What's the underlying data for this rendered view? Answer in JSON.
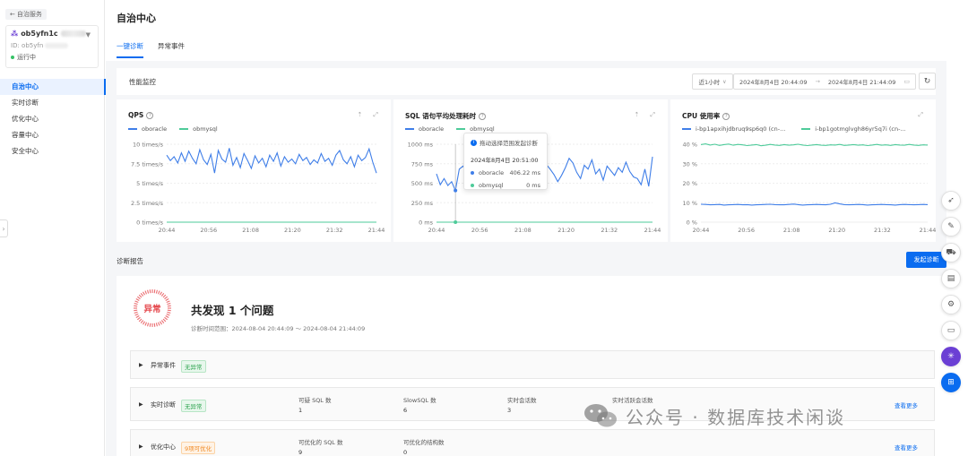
{
  "sidebar": {
    "back_label": "自治服务",
    "instance": {
      "name": "ob5yfn1c",
      "id_label": "ID: ob5yfn",
      "status": "运行中"
    },
    "nav": [
      {
        "label": "自治中心",
        "active": true
      },
      {
        "label": "实时诊断",
        "active": false
      },
      {
        "label": "优化中心",
        "active": false
      },
      {
        "label": "容量中心",
        "active": false
      },
      {
        "label": "安全中心",
        "active": false
      }
    ]
  },
  "header": {
    "title": "自治中心",
    "tabs": [
      {
        "label": "一键诊断",
        "active": true
      },
      {
        "label": "异常事件",
        "active": false
      }
    ]
  },
  "perf": {
    "title": "性能监控",
    "range": "近1小时",
    "start": "2024年8月4日 20:44:09",
    "end": "2024年8月4日 21:44:09",
    "arrow": "→"
  },
  "colors": {
    "oboracle": "#3f7ee8",
    "obmysql": "#4ecb9a",
    "accent": "#0a6cf0",
    "abnormal": "#e5484d"
  },
  "charts": [
    {
      "title": "QPS",
      "legend": [
        "oboracle",
        "obmysql"
      ]
    },
    {
      "title": "SQL 语句平均处理耗时",
      "legend": [
        "oboracle",
        "obmysql"
      ]
    },
    {
      "title": "CPU 使用率",
      "legend": [
        "i-bp1apxihjdbruq9sp6q0 (cn-...",
        "i-bp1gotmglvgh86yr5q7i (cn-..."
      ]
    }
  ],
  "chart_data": [
    {
      "type": "line",
      "title": "QPS",
      "x": [
        "20:44",
        "20:56",
        "21:08",
        "21:20",
        "21:32",
        "21:44"
      ],
      "yticks": [
        "0 times/s",
        "2.5 times/s",
        "5 times/s",
        "7.5 times/s",
        "10 times/s"
      ],
      "ylim": [
        0,
        10
      ],
      "series": [
        {
          "name": "oboracle",
          "values": [
            8.6,
            7.9,
            8.4,
            7.6,
            8.9,
            7.8,
            9.1,
            8.2,
            7.5,
            9.3,
            8.0,
            7.4,
            8.7,
            6.3,
            9.2,
            8.1,
            7.7,
            9.5,
            7.3,
            8.3,
            7.0,
            8.8,
            7.9,
            6.9,
            8.5,
            7.6,
            8.2,
            7.1,
            8.6,
            7.8,
            8.9,
            7.2,
            8.4,
            7.7,
            8.1,
            7.5,
            8.7,
            7.9,
            8.3,
            7.4,
            8.0,
            7.6,
            8.8,
            7.8,
            8.2,
            7.3,
            8.6,
            9.2,
            8.0,
            7.5,
            8.4,
            7.1,
            8.6,
            7.9,
            8.3,
            9.4,
            7.7,
            6.3
          ]
        },
        {
          "name": "obmysql",
          "values": [
            0,
            0,
            0,
            0,
            0,
            0,
            0,
            0,
            0,
            0,
            0,
            0,
            0,
            0,
            0,
            0,
            0,
            0,
            0,
            0,
            0,
            0,
            0,
            0,
            0,
            0,
            0,
            0,
            0,
            0,
            0,
            0,
            0,
            0,
            0,
            0,
            0,
            0,
            0,
            0,
            0,
            0,
            0,
            0,
            0,
            0,
            0,
            0,
            0,
            0,
            0,
            0,
            0,
            0,
            0,
            0,
            0,
            0
          ]
        }
      ]
    },
    {
      "type": "line",
      "title": "SQL 语句平均处理耗时",
      "x": [
        "20:44",
        "20:56",
        "21:08",
        "21:20",
        "21:32",
        "21:44"
      ],
      "yticks": [
        "0 ms",
        "250 ms",
        "500 ms",
        "750 ms",
        "1000 ms"
      ],
      "ylim": [
        0,
        1000
      ],
      "series": [
        {
          "name": "oboracle",
          "values": [
            620,
            480,
            560,
            470,
            520,
            406,
            680,
            720,
            650,
            800,
            590,
            520,
            700,
            640,
            610,
            560,
            620,
            540,
            680,
            820,
            600,
            520,
            760,
            640,
            700,
            560,
            620,
            590,
            700,
            740,
            680,
            610,
            520,
            600,
            700,
            820,
            760,
            640,
            560,
            730,
            680,
            800,
            620,
            680,
            540,
            720,
            660,
            600,
            700,
            640,
            770,
            650,
            580,
            560,
            480,
            680,
            460,
            840
          ]
        },
        {
          "name": "obmysql",
          "values": [
            0,
            0,
            0,
            0,
            0,
            0,
            0,
            0,
            0,
            0,
            0,
            0,
            0,
            0,
            0,
            0,
            0,
            0,
            0,
            0,
            0,
            0,
            0,
            0,
            0,
            0,
            0,
            0,
            0,
            0,
            0,
            0,
            0,
            0,
            0,
            0,
            0,
            0,
            0,
            0,
            0,
            0,
            0,
            0,
            0,
            0,
            0,
            0,
            0,
            0,
            0,
            0,
            0,
            0,
            0,
            0,
            0,
            0
          ]
        }
      ]
    },
    {
      "type": "line",
      "title": "CPU 使用率",
      "x": [
        "20:44",
        "20:56",
        "21:08",
        "21:20",
        "21:32",
        "21:44"
      ],
      "yticks": [
        "0 %",
        "10 %",
        "20 %",
        "30 %",
        "40 %"
      ],
      "ylim": [
        0,
        40
      ],
      "series": [
        {
          "name": "i-bp1apxihjdbruq9sp6q0 (cn-...",
          "values": [
            9.2,
            9.1,
            8.9,
            9.0,
            9.1,
            8.8,
            8.9,
            9.0,
            9.1,
            8.9,
            9.0,
            8.8,
            8.9,
            9.0,
            9.1,
            9.2,
            9.0,
            8.9,
            8.9,
            9.1,
            9.3,
            9.0,
            8.8,
            8.9,
            9.0,
            9.1,
            9.0,
            8.9,
            9.2,
            9.9,
            9.4,
            9.0,
            8.9,
            9.0,
            9.1,
            9.0,
            8.8,
            8.9,
            9.0,
            9.1,
            9.0,
            8.9,
            8.8,
            9.0,
            9.1,
            9.0,
            8.9,
            9.0,
            9.1,
            9.0
          ]
        },
        {
          "name": "i-bp1gotmglvgh86yr5q7i (cn-...",
          "values": [
            39.8,
            40.2,
            39.6,
            40.0,
            39.4,
            39.8,
            40.1,
            39.5,
            39.9,
            39.7,
            39.3,
            39.6,
            39.8,
            39.2,
            39.5,
            39.9,
            39.6,
            39.4,
            39.8,
            39.5,
            39.7,
            40.0,
            39.6,
            39.3,
            39.6,
            39.8,
            39.5,
            39.4,
            39.7,
            39.6,
            39.9,
            39.4,
            39.6,
            39.8,
            39.5,
            39.7,
            39.3,
            39.6,
            39.9,
            39.5,
            39.7,
            39.4,
            39.8,
            39.6,
            39.5,
            39.9,
            39.6,
            39.4,
            39.7,
            39.6
          ]
        }
      ]
    }
  ],
  "tooltip": {
    "hint": "拖动选择范围发起诊断",
    "time": "2024年8月4日 20:51:00",
    "rows": [
      {
        "name": "oboracle",
        "value": "406.22 ms"
      },
      {
        "name": "obmysql",
        "value": "0 ms"
      }
    ]
  },
  "report": {
    "title": "诊断报告",
    "start_button": "发起诊断",
    "badge": "异常",
    "found": "共发现 1 个问题",
    "range_label": "诊断时间范围：2024-08-04 20:44:09 ～ 2024-08-04 21:44:09",
    "sections": [
      {
        "name": "异常事件",
        "tag": "无异常",
        "tag_type": "green",
        "metrics": [],
        "see_more": ""
      },
      {
        "name": "实时诊断",
        "tag": "无异常",
        "tag_type": "green",
        "metrics": [
          {
            "label": "可疑 SQL 数",
            "value": "1"
          },
          {
            "label": "SlowSQL 数",
            "value": "6"
          },
          {
            "label": "实时会话数",
            "value": "3"
          },
          {
            "label": "实时活跃会话数",
            "value": ""
          }
        ],
        "see_more": "查看更多"
      },
      {
        "name": "优化中心",
        "tag": "9项可优化",
        "tag_type": "orange",
        "metrics": [
          {
            "label": "可优化的 SQL 数",
            "value": "9"
          },
          {
            "label": "可优化的结构数",
            "value": "0"
          }
        ],
        "see_more": "查看更多"
      }
    ]
  },
  "watermark": "公众号 · 数据库技术闲谈"
}
